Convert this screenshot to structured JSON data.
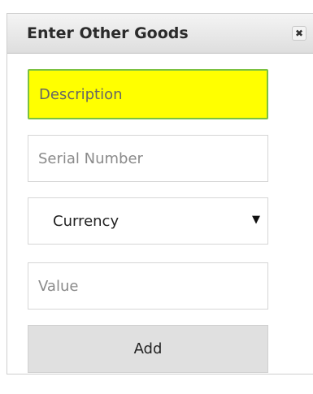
{
  "dialog": {
    "title": "Enter Other Goods",
    "close_glyph": "✖"
  },
  "form": {
    "description_placeholder": "Description",
    "serial_placeholder": "Serial Number",
    "currency_label": "Currency",
    "currency_arrow": "▼",
    "value_placeholder": "Value",
    "add_label": "Add"
  },
  "colors": {
    "focused_field_bg": "#ffff00",
    "focused_field_border": "#7bc142",
    "button_bg": "#e0e0e0"
  }
}
